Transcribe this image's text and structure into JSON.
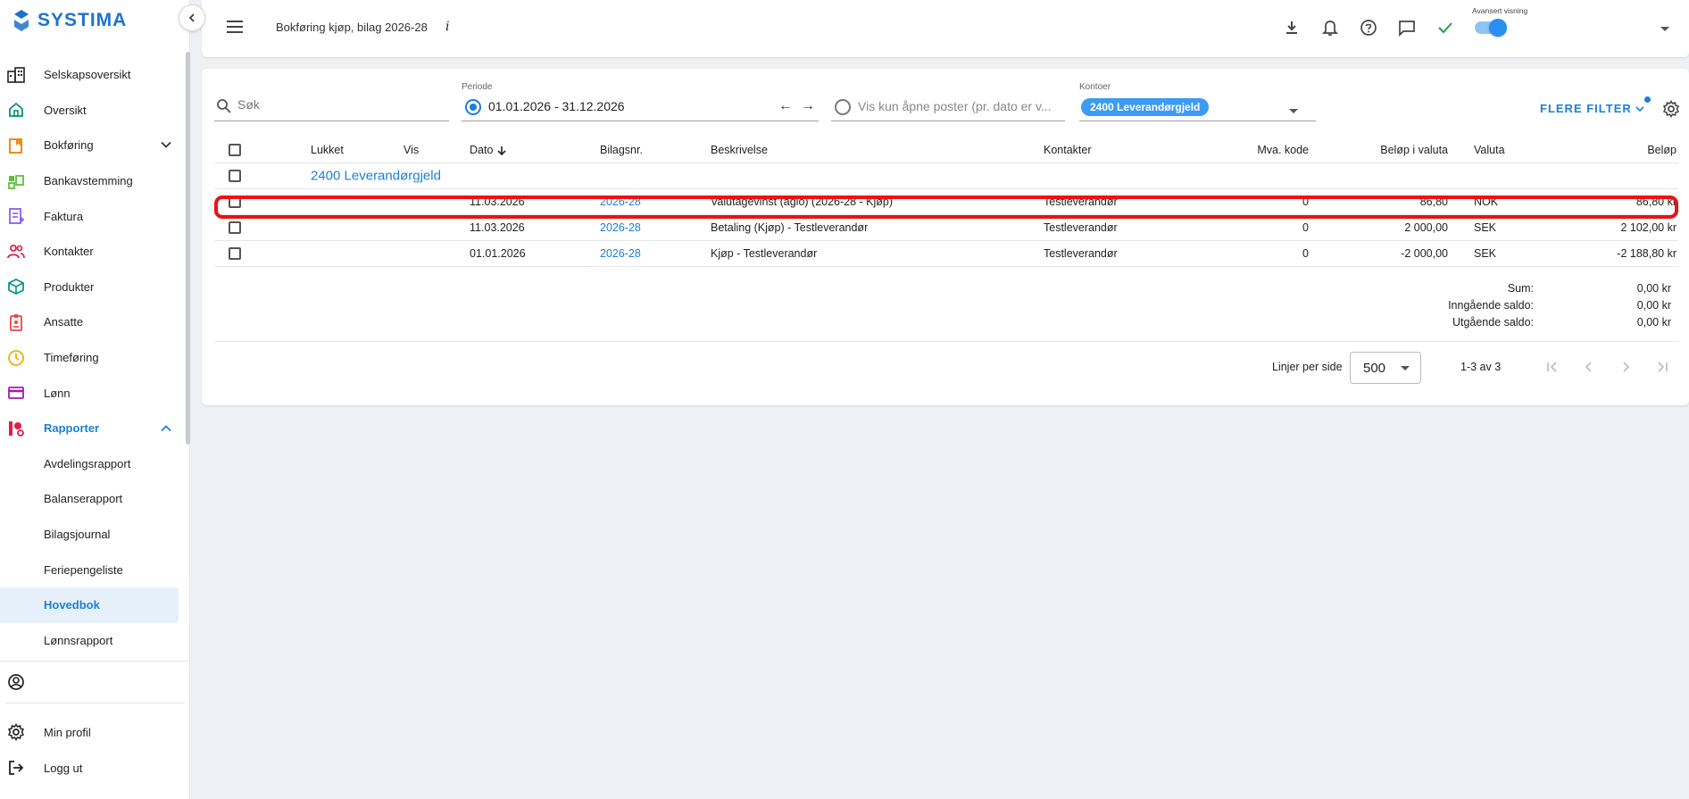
{
  "app": {
    "brand": "SYSTIMA"
  },
  "sidebar": {
    "items": [
      {
        "label": "Selskapsoversikt",
        "icon": "building-icon"
      },
      {
        "label": "Oversikt",
        "icon": "home-icon"
      },
      {
        "label": "Bokføring",
        "icon": "bookkeeping-icon"
      },
      {
        "label": "Bankavstemming",
        "icon": "bank-icon"
      },
      {
        "label": "Faktura",
        "icon": "invoice-icon"
      },
      {
        "label": "Kontakter",
        "icon": "contacts-icon"
      },
      {
        "label": "Produkter",
        "icon": "box-icon"
      },
      {
        "label": "Ansatte",
        "icon": "badge-icon"
      },
      {
        "label": "Timeføring",
        "icon": "clock-icon"
      },
      {
        "label": "Lønn",
        "icon": "card-icon"
      },
      {
        "label": "Rapporter",
        "icon": "reports-icon"
      }
    ],
    "subitems": [
      {
        "label": "Avdelingsrapport"
      },
      {
        "label": "Balanserapport"
      },
      {
        "label": "Bilagsjournal"
      },
      {
        "label": "Feriepengeliste"
      },
      {
        "label": "Hovedbok"
      },
      {
        "label": "Lønnsrapport"
      }
    ],
    "bottom": [
      {
        "label": "",
        "icon": "user-circle-icon"
      },
      {
        "label": "Min profil",
        "icon": "gear-icon"
      },
      {
        "label": "Logg ut",
        "icon": "logout-icon"
      }
    ]
  },
  "header": {
    "title": "Bokføring kjøp, bilag 2026-28",
    "info": "i",
    "advanced_label": "Avansert visning"
  },
  "filters": {
    "search_placeholder": "Søk",
    "period_label": "Periode",
    "period_value": "01.01.2026 - 31.12.2026",
    "open_posts_text": "Vis kun åpne poster (pr. dato er v...",
    "accounts_label": "Kontoer",
    "account_chip": "2400 Leverandørgjeld",
    "more_filters": "FLERE FILTER"
  },
  "table": {
    "headers": {
      "lukket": "Lukket",
      "vis": "Vis",
      "dato": "Dato",
      "bilagsnr": "Bilagsnr.",
      "beskrivelse": "Beskrivelse",
      "kontakter": "Kontakter",
      "mva": "Mva. kode",
      "belop_valuta": "Beløp i valuta",
      "valuta": "Valuta",
      "belop": "Beløp"
    },
    "group": "2400 Leverandørgjeld",
    "rows": [
      {
        "dato": "11.03.2026",
        "bilagsnr": "2026-28",
        "beskrivelse": "Valutagevinst (agio) (2026-28 - Kjøp)",
        "kontakt": "Testleverandør",
        "mva": "0",
        "belop_valuta": "86,80",
        "valuta": "NOK",
        "belop": "86,80 kr"
      },
      {
        "dato": "11.03.2026",
        "bilagsnr": "2026-28",
        "beskrivelse": "Betaling (Kjøp) - Testleverandør",
        "kontakt": "Testleverandør",
        "mva": "0",
        "belop_valuta": "2 000,00",
        "valuta": "SEK",
        "belop": "2 102,00 kr"
      },
      {
        "dato": "01.01.2026",
        "bilagsnr": "2026-28",
        "beskrivelse": "Kjøp - Testleverandør",
        "kontakt": "Testleverandør",
        "mva": "0",
        "belop_valuta": "-2 000,00",
        "valuta": "SEK",
        "belop": "-2 188,80 kr"
      }
    ]
  },
  "summary": {
    "sum_label": "Sum:",
    "sum_value": "0,00 kr",
    "in_label": "Inngående saldo:",
    "in_value": "0,00 kr",
    "out_label": "Utgående saldo:",
    "out_value": "0,00 kr"
  },
  "pagination": {
    "per_page_label": "Linjer per side",
    "per_page_value": "500",
    "range": "1-3 av 3"
  },
  "colors": {
    "accent": "#1d7fd6",
    "highlight": "#ee1111",
    "chip": "#3d9bf2"
  }
}
